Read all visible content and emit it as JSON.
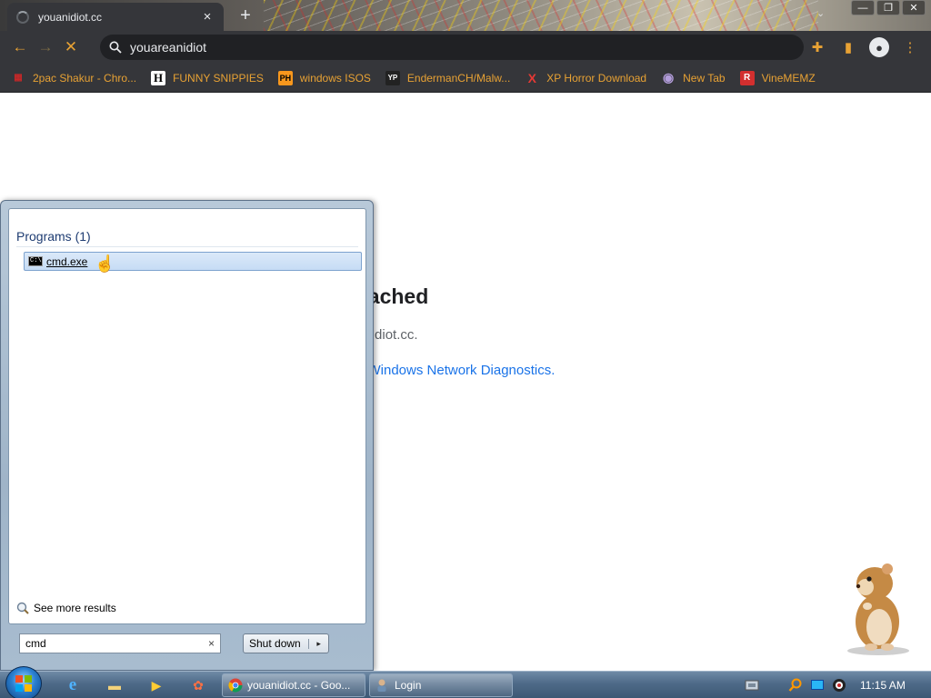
{
  "browser": {
    "tab_title": "youanidiot.cc",
    "tab_close": "×",
    "new_tab": "+",
    "dropdown": "⌄",
    "window_buttons": {
      "minimize": "—",
      "restore": "❐",
      "close": "✕"
    },
    "omnibox_value": "youareanidiot",
    "nav": {
      "back": "←",
      "forward": "→",
      "stop": "✕"
    },
    "toolbar_icons": {
      "extensions": "✚",
      "side_panel": "▮",
      "profile": "●"
    },
    "bookmarks": [
      {
        "label": "2pac Shakur - Chro...",
        "icon": "gift-icon",
        "color": "#c62828",
        "glyph": "▦"
      },
      {
        "label": "FUNNY SNIPPIES",
        "icon": "h-icon",
        "color": "#ffffff",
        "glyph": "H"
      },
      {
        "label": "windows ISOS",
        "icon": "ph-icon",
        "color": "#f7971d",
        "glyph": "PH"
      },
      {
        "label": "EndermanCH/Malw...",
        "icon": "yp-icon",
        "color": "#222222",
        "glyph": "YP"
      },
      {
        "label": "XP Horror Download",
        "icon": "x-icon",
        "color": "#d32f2f",
        "glyph": "X"
      },
      {
        "label": "New Tab",
        "icon": "globe-icon",
        "color": "#9575cd",
        "glyph": "◉"
      },
      {
        "label": "VineMEMZ",
        "icon": "r-icon",
        "color": "#d32f2f",
        "glyph": "R"
      }
    ]
  },
  "page": {
    "error_title": "eached",
    "error_host": "anidiot.cc.",
    "diagnostics_link": "g Windows Network Diagnostics."
  },
  "start_menu": {
    "programs_header": "Programs (1)",
    "program_item": "cmd.exe",
    "cmd_icon_text": "C:\\",
    "cursor": "☝",
    "see_more": "See more results",
    "search_value": "cmd",
    "search_clear": "×",
    "shutdown_label": "Shut down",
    "shutdown_arrow": "▸"
  },
  "taskbar": {
    "tasks": [
      {
        "label": "youanidiot.cc - Goo...",
        "icon": "chrome-icon"
      },
      {
        "label": "Login",
        "icon": "login-icon"
      }
    ],
    "quick_glyphs": {
      "ie": "e",
      "explorer": "▬",
      "media": "▶",
      "game": "✿"
    },
    "clock": "11:15 AM"
  },
  "colors": {
    "chrome_dark": "#35363a",
    "accent_orange": "#e8a234",
    "link_blue": "#1a73e8",
    "taskbar": "#4e6a88"
  }
}
